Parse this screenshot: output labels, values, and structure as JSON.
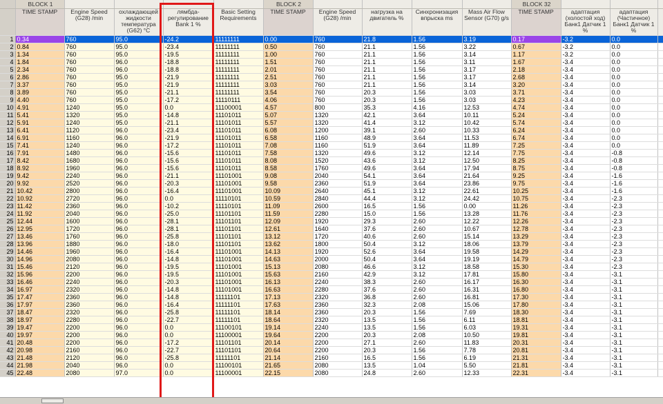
{
  "blocks": {
    "b1": "BLOCK 1",
    "b2": "BLOCK 2",
    "b3": "BLOCK 32"
  },
  "headers": [
    {
      "key": "ts1",
      "label": "TIME STAMP"
    },
    {
      "key": "es1",
      "label": "Engine Speed (G28) /min"
    },
    {
      "key": "cool",
      "label": "охлаждающей жидкости температура (G62) °C"
    },
    {
      "key": "lam",
      "label": "лямбда-регулирование Bank 1 %"
    },
    {
      "key": "basic",
      "label": "Basic Setting Requirements"
    },
    {
      "key": "ts2",
      "label": "TIME STAMP"
    },
    {
      "key": "es2",
      "label": "Engine Speed (G28) /min"
    },
    {
      "key": "load",
      "label": "нагрузка на двигатель %"
    },
    {
      "key": "sync",
      "label": "Синхронизация впрыска ms"
    },
    {
      "key": "maf",
      "label": "Mass Air Flow Sensor (G70) g/s"
    },
    {
      "key": "ts3",
      "label": "TIME STAMP"
    },
    {
      "key": "ad1",
      "label": "адаптация (холостой ход) Банк1 Датчик 1 %"
    },
    {
      "key": "ad2",
      "label": "адаптация (Частичное) Банк1 Датчик 1 %"
    }
  ],
  "rows": [
    [
      "0.34",
      "760",
      "95.0",
      "-24.2",
      "11111111",
      "0.00",
      "760",
      "21.8",
      "1.56",
      "3.19",
      "0.17",
      "-3.2",
      "0.0"
    ],
    [
      "0.84",
      "760",
      "95.0",
      "-23.4",
      "11111111",
      "0.50",
      "760",
      "21.1",
      "1.56",
      "3.22",
      "0.67",
      "-3.2",
      "0.0"
    ],
    [
      "1.34",
      "760",
      "95.0",
      "-19.5",
      "11111111",
      "1.00",
      "760",
      "21.1",
      "1.56",
      "3.14",
      "1.17",
      "-3.2",
      "0.0"
    ],
    [
      "1.84",
      "760",
      "96.0",
      "-18.8",
      "11111111",
      "1.51",
      "760",
      "21.1",
      "1.56",
      "3.11",
      "1.67",
      "-3.4",
      "0.0"
    ],
    [
      "2.34",
      "760",
      "96.0",
      "-18.8",
      "11111111",
      "2.01",
      "760",
      "21.1",
      "1.56",
      "3.17",
      "2.18",
      "-3.4",
      "0.0"
    ],
    [
      "2.86",
      "760",
      "95.0",
      "-21.9",
      "11111111",
      "2.51",
      "760",
      "21.1",
      "1.56",
      "3.17",
      "2.68",
      "-3.4",
      "0.0"
    ],
    [
      "3.37",
      "760",
      "95.0",
      "-21.9",
      "11111111",
      "3.03",
      "760",
      "21.1",
      "1.56",
      "3.14",
      "3.20",
      "-3.4",
      "0.0"
    ],
    [
      "3.89",
      "760",
      "95.0",
      "-21.1",
      "11111111",
      "3.54",
      "760",
      "20.3",
      "1.56",
      "3.03",
      "3.71",
      "-3.4",
      "0.0"
    ],
    [
      "4.40",
      "760",
      "95.0",
      "-17.2",
      "11110111",
      "4.06",
      "760",
      "20.3",
      "1.56",
      "3.03",
      "4.23",
      "-3.4",
      "0.0"
    ],
    [
      "4.91",
      "1240",
      "95.0",
      "0.0",
      "11100001",
      "4.57",
      "800",
      "35.3",
      "4.16",
      "12.53",
      "4.74",
      "-3.4",
      "0.0"
    ],
    [
      "5.41",
      "1320",
      "95.0",
      "-14.8",
      "11101011",
      "5.07",
      "1320",
      "42.1",
      "3.64",
      "10.11",
      "5.24",
      "-3.4",
      "0.0"
    ],
    [
      "5.91",
      "1240",
      "95.0",
      "-21.1",
      "11101011",
      "5.57",
      "1320",
      "41.4",
      "3.12",
      "10.42",
      "5.74",
      "-3.4",
      "0.0"
    ],
    [
      "6.41",
      "1120",
      "96.0",
      "-23.4",
      "11101011",
      "6.08",
      "1200",
      "39.1",
      "2.60",
      "10.33",
      "6.24",
      "-3.4",
      "0.0"
    ],
    [
      "6.91",
      "1160",
      "96.0",
      "-21.9",
      "11101011",
      "6.58",
      "1160",
      "48.9",
      "3.64",
      "11.53",
      "6.74",
      "-3.4",
      "0.0"
    ],
    [
      "7.41",
      "1240",
      "96.0",
      "-17.2",
      "11101011",
      "7.08",
      "1160",
      "51.9",
      "3.64",
      "11.89",
      "7.25",
      "-3.4",
      "0.0"
    ],
    [
      "7.91",
      "1480",
      "96.0",
      "-15.6",
      "11101011",
      "7.58",
      "1320",
      "49.6",
      "3.12",
      "12.14",
      "7.75",
      "-3.4",
      "-0.8"
    ],
    [
      "8.42",
      "1680",
      "96.0",
      "-15.6",
      "11101011",
      "8.08",
      "1520",
      "43.6",
      "3.12",
      "12.50",
      "8.25",
      "-3.4",
      "-0.8"
    ],
    [
      "8.92",
      "1960",
      "96.0",
      "-15.6",
      "11101011",
      "8.58",
      "1760",
      "49.6",
      "3.64",
      "17.94",
      "8.75",
      "-3.4",
      "-0.8"
    ],
    [
      "9.42",
      "2240",
      "96.0",
      "-21.1",
      "11101001",
      "9.08",
      "2040",
      "54.1",
      "3.64",
      "21.64",
      "9.25",
      "-3.4",
      "-1.6"
    ],
    [
      "9.92",
      "2520",
      "96.0",
      "-20.3",
      "11101001",
      "9.58",
      "2360",
      "51.9",
      "3.64",
      "23.86",
      "9.75",
      "-3.4",
      "-1.6"
    ],
    [
      "10.42",
      "2800",
      "96.0",
      "-16.4",
      "11101001",
      "10.09",
      "2640",
      "45.1",
      "3.12",
      "22.61",
      "10.25",
      "-3.4",
      "-1.6"
    ],
    [
      "10.92",
      "2720",
      "96.0",
      "0.0",
      "11110101",
      "10.59",
      "2840",
      "44.4",
      "3.12",
      "24.42",
      "10.75",
      "-3.4",
      "-2.3"
    ],
    [
      "11.42",
      "2360",
      "96.0",
      "-10.2",
      "11110101",
      "11.09",
      "2600",
      "16.5",
      "1.56",
      "0.00",
      "11.26",
      "-3.4",
      "-2.3"
    ],
    [
      "11.92",
      "2040",
      "96.0",
      "-25.0",
      "11101101",
      "11.59",
      "2280",
      "15.0",
      "1.56",
      "13.28",
      "11.76",
      "-3.4",
      "-2.3"
    ],
    [
      "12.44",
      "1600",
      "96.0",
      "-28.1",
      "11101101",
      "12.09",
      "1920",
      "29.3",
      "2.60",
      "12.22",
      "12.26",
      "-3.4",
      "-2.3"
    ],
    [
      "12.95",
      "1720",
      "96.0",
      "-28.1",
      "11101101",
      "12.61",
      "1640",
      "37.6",
      "2.60",
      "10.67",
      "12.78",
      "-3.4",
      "-2.3"
    ],
    [
      "13.46",
      "1760",
      "96.0",
      "-25.8",
      "11101101",
      "13.12",
      "1720",
      "40.6",
      "2.60",
      "15.14",
      "13.29",
      "-3.4",
      "-2.3"
    ],
    [
      "13.96",
      "1880",
      "96.0",
      "-18.0",
      "11101101",
      "13.62",
      "1800",
      "50.4",
      "3.12",
      "18.06",
      "13.79",
      "-3.4",
      "-2.3"
    ],
    [
      "14.46",
      "1960",
      "96.0",
      "-16.4",
      "11101001",
      "14.13",
      "1920",
      "52.6",
      "3.64",
      "19.58",
      "14.29",
      "-3.4",
      "-2.3"
    ],
    [
      "14.96",
      "2080",
      "96.0",
      "-14.8",
      "11101001",
      "14.63",
      "2000",
      "50.4",
      "3.64",
      "19.19",
      "14.79",
      "-3.4",
      "-2.3"
    ],
    [
      "15.46",
      "2120",
      "96.0",
      "-19.5",
      "11101001",
      "15.13",
      "2080",
      "46.6",
      "3.12",
      "18.58",
      "15.30",
      "-3.4",
      "-2.3"
    ],
    [
      "15.96",
      "2200",
      "96.0",
      "-19.5",
      "11101001",
      "15.63",
      "2160",
      "42.9",
      "3.12",
      "17.81",
      "15.80",
      "-3.4",
      "-3.1"
    ],
    [
      "16.46",
      "2240",
      "96.0",
      "-20.3",
      "11101001",
      "16.13",
      "2240",
      "38.3",
      "2.60",
      "16.17",
      "16.30",
      "-3.4",
      "-3.1"
    ],
    [
      "16.97",
      "2320",
      "96.0",
      "-14.8",
      "11101001",
      "16.63",
      "2280",
      "37.6",
      "2.60",
      "16.31",
      "16.80",
      "-3.4",
      "-3.1"
    ],
    [
      "17.47",
      "2360",
      "96.0",
      "-14.8",
      "11111101",
      "17.13",
      "2320",
      "36.8",
      "2.60",
      "16.81",
      "17.30",
      "-3.4",
      "-3.1"
    ],
    [
      "17.97",
      "2360",
      "96.0",
      "-16.4",
      "11111101",
      "17.63",
      "2360",
      "32.3",
      "2.08",
      "15.06",
      "17.80",
      "-3.4",
      "-3.1"
    ],
    [
      "18.47",
      "2320",
      "96.0",
      "-25.8",
      "11111101",
      "18.14",
      "2360",
      "20.3",
      "1.56",
      "7.69",
      "18.30",
      "-3.4",
      "-3.1"
    ],
    [
      "18.97",
      "2280",
      "96.0",
      "-22.7",
      "11111101",
      "18.64",
      "2320",
      "13.5",
      "1.56",
      "6.11",
      "18.81",
      "-3.4",
      "-3.1"
    ],
    [
      "19.47",
      "2200",
      "96.0",
      "0.0",
      "11100101",
      "19.14",
      "2240",
      "13.5",
      "1.56",
      "6.03",
      "19.31",
      "-3.4",
      "-3.1"
    ],
    [
      "19.97",
      "2200",
      "96.0",
      "0.0",
      "11100001",
      "19.64",
      "2200",
      "20.3",
      "2.08",
      "10.50",
      "19.81",
      "-3.4",
      "-3.1"
    ],
    [
      "20.48",
      "2200",
      "96.0",
      "-17.2",
      "11101101",
      "20.14",
      "2200",
      "27.1",
      "2.60",
      "11.83",
      "20.31",
      "-3.4",
      "-3.1"
    ],
    [
      "20.98",
      "2160",
      "96.0",
      "-22.7",
      "11101101",
      "20.64",
      "2200",
      "20.3",
      "1.56",
      "7.78",
      "20.81",
      "-3.4",
      "-3.1"
    ],
    [
      "21.48",
      "2120",
      "96.0",
      "-25.8",
      "11111101",
      "21.14",
      "2160",
      "16.5",
      "1.56",
      "6.19",
      "21.31",
      "-3.4",
      "-3.1"
    ],
    [
      "21.98",
      "2040",
      "96.0",
      "0.0",
      "11100101",
      "21.65",
      "2080",
      "13.5",
      "1.04",
      "5.50",
      "21.81",
      "-3.4",
      "-3.1"
    ],
    [
      "22.48",
      "2080",
      "97.0",
      "0.0",
      "11100001",
      "22.15",
      "2080",
      "24.8",
      "2.60",
      "12.33",
      "22.31",
      "-3.4",
      "-3.1"
    ]
  ]
}
